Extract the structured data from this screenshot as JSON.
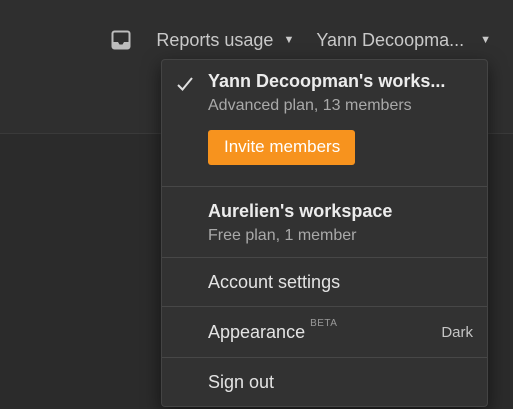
{
  "topbar": {
    "inbox_icon": "inbox-icon",
    "reports_label": "Reports usage",
    "workspace_label": "Yann Decoopma..."
  },
  "menu": {
    "current_workspace": {
      "name": "Yann Decoopman's works...",
      "plan": "Advanced plan, 13 members",
      "invite_label": "Invite members"
    },
    "other_workspace": {
      "name": "Aurelien's workspace",
      "plan": "Free plan, 1 member"
    },
    "account_settings_label": "Account settings",
    "appearance": {
      "label": "Appearance",
      "badge": "BETA",
      "value": "Dark"
    },
    "sign_out_label": "Sign out"
  },
  "colors": {
    "accent": "#f7931e",
    "background": "#2b2b2b",
    "menu_background": "#323232"
  }
}
